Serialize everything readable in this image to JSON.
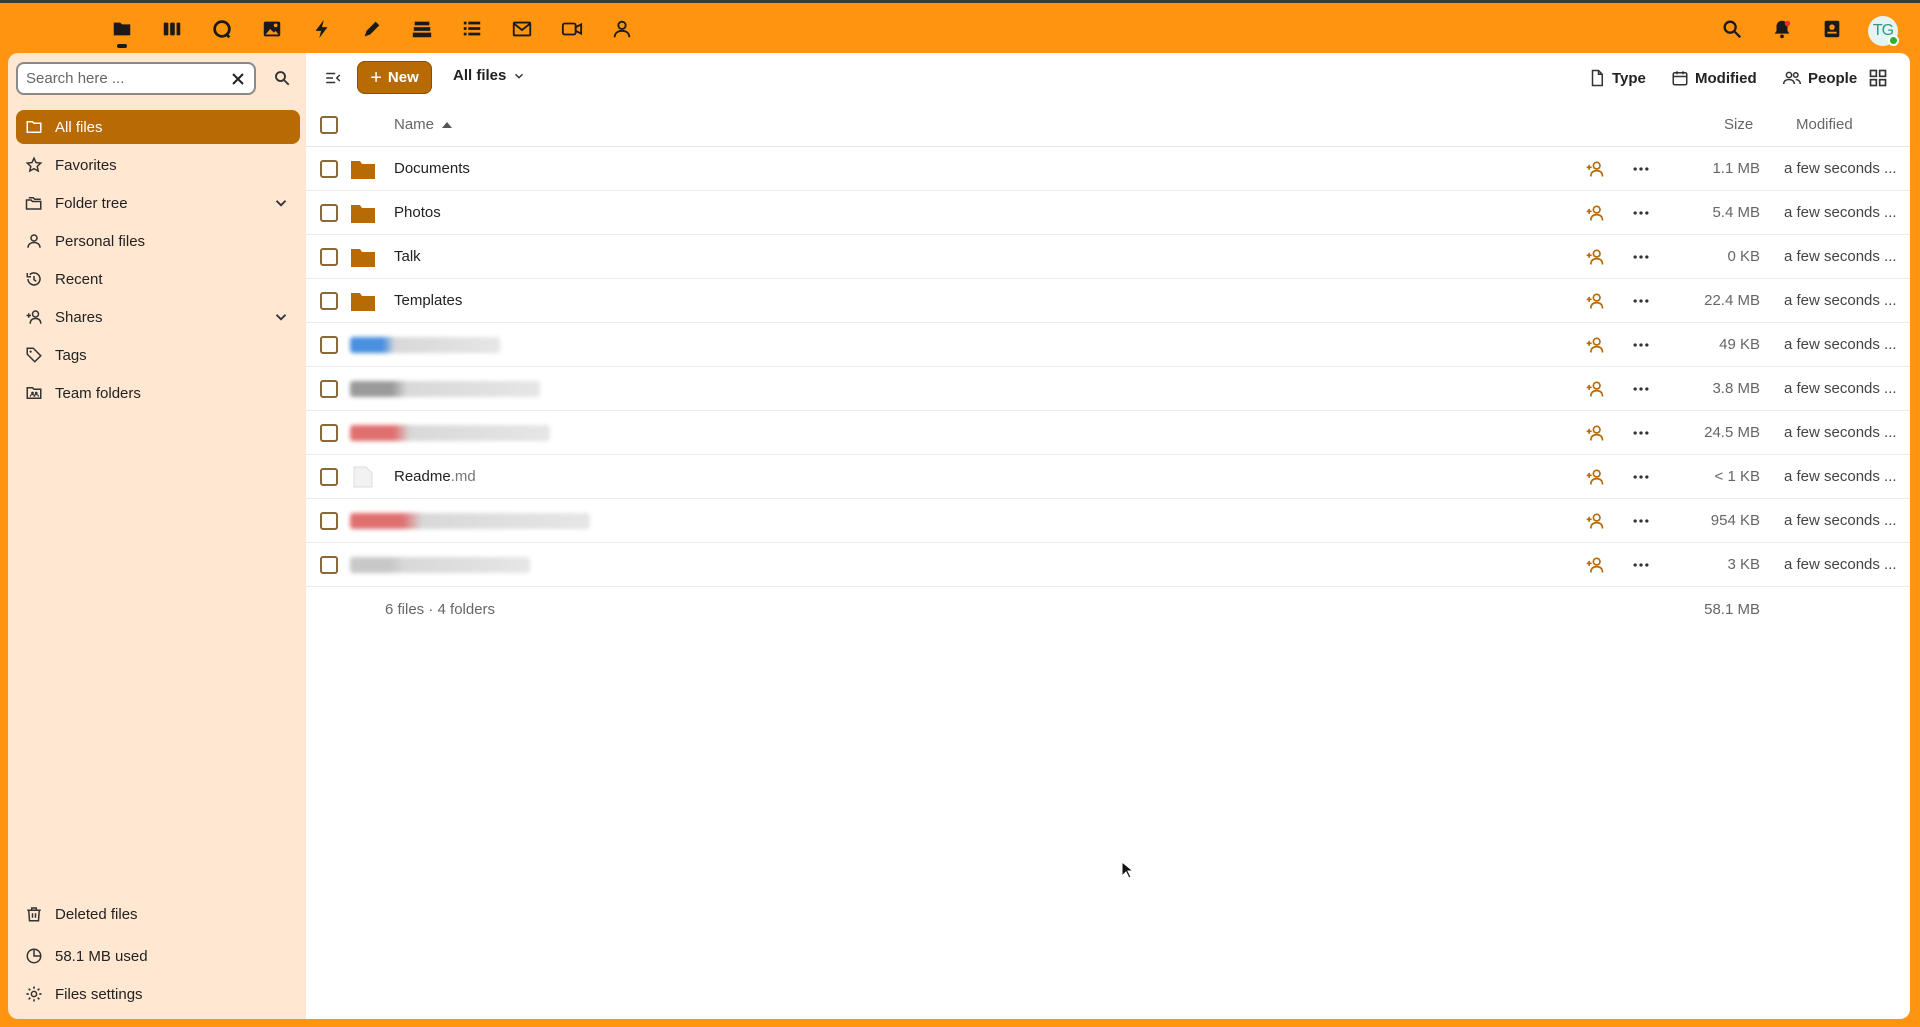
{
  "topbar": {
    "apps": [
      {
        "name": "files-app-icon"
      },
      {
        "name": "dashboard-app-icon"
      },
      {
        "name": "talk-app-icon"
      },
      {
        "name": "photos-app-icon"
      },
      {
        "name": "activity-app-icon"
      },
      {
        "name": "notes-app-icon"
      },
      {
        "name": "deck-app-icon"
      },
      {
        "name": "tasks-app-icon"
      },
      {
        "name": "mail-app-icon"
      },
      {
        "name": "video-app-icon"
      },
      {
        "name": "contacts-app-icon"
      }
    ],
    "avatar_initials": "TG"
  },
  "sidebar": {
    "search_placeholder": "Search here ...",
    "items": [
      {
        "label": "All files",
        "icon": "folder-icon",
        "active": true
      },
      {
        "label": "Favorites",
        "icon": "star-icon"
      },
      {
        "label": "Folder tree",
        "icon": "folder-tree-icon",
        "expandable": true
      },
      {
        "label": "Personal files",
        "icon": "person-icon"
      },
      {
        "label": "Recent",
        "icon": "history-icon"
      },
      {
        "label": "Shares",
        "icon": "share-icon",
        "expandable": true
      },
      {
        "label": "Tags",
        "icon": "tag-icon"
      },
      {
        "label": "Team folders",
        "icon": "team-folder-icon"
      }
    ],
    "bottom": {
      "deleted": "Deleted files",
      "quota": "58.1 MB used",
      "settings": "Files settings"
    }
  },
  "toolbar": {
    "new_label": "New",
    "breadcrumb": "All files",
    "filters": {
      "type": "Type",
      "modified": "Modified",
      "people": "People"
    }
  },
  "table": {
    "columns": {
      "name": "Name",
      "size": "Size",
      "modified": "Modified"
    },
    "rows": [
      {
        "name": "Documents",
        "ext": "",
        "kind": "folder",
        "size": "1.1 MB",
        "modified": "a few seconds ..."
      },
      {
        "name": "Photos",
        "ext": "",
        "kind": "folder",
        "size": "5.4 MB",
        "modified": "a few seconds ..."
      },
      {
        "name": "Talk",
        "ext": "",
        "kind": "folder",
        "size": "0 KB",
        "modified": "a few seconds ..."
      },
      {
        "name": "Templates",
        "ext": "",
        "kind": "folder",
        "size": "22.4 MB",
        "modified": "a few seconds ..."
      },
      {
        "name": "",
        "ext": "",
        "kind": "blurred",
        "blur_color": "#4a8fe0",
        "size": "49 KB",
        "modified": "a few seconds ..."
      },
      {
        "name": "",
        "ext": "",
        "kind": "blurred",
        "blur_color": "#9a9a9a",
        "size": "3.8 MB",
        "modified": "a few seconds ..."
      },
      {
        "name": "",
        "ext": "",
        "kind": "blurred",
        "blur_color": "#e07070",
        "size": "24.5 MB",
        "modified": "a few seconds ..."
      },
      {
        "name": "Readme",
        "ext": ".md",
        "kind": "file",
        "size": "< 1 KB",
        "modified": "a few seconds ..."
      },
      {
        "name": "",
        "ext": "",
        "kind": "blurred",
        "blur_color": "#e07070",
        "size": "954 KB",
        "modified": "a few seconds ..."
      },
      {
        "name": "",
        "ext": "",
        "kind": "blurred",
        "blur_color": "#c8c8c8",
        "size": "3 KB",
        "modified": "a few seconds ..."
      }
    ],
    "summary": "6 files · 4 folders",
    "total_size": "58.1 MB"
  },
  "colors": {
    "brand": "#ff9411",
    "accent": "#b86a05",
    "sidebar_bg": "#ffe7d1",
    "folder": "#b86a05"
  }
}
